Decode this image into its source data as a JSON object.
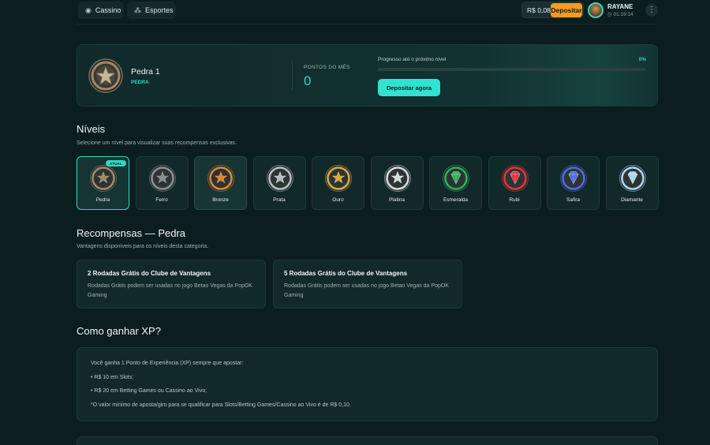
{
  "nav": {
    "casino_label": "Cassino",
    "sports_label": "Esportes"
  },
  "account": {
    "balance": "R$ 0,08",
    "deposit_label": "Depositar",
    "username": "RAYANE",
    "time": "01:19:14"
  },
  "hero": {
    "level_name": "Pedra 1",
    "level_tier": "PEDRA",
    "points_label": "PONTOS DO MÊS",
    "points_value": "0",
    "progress_label": "Progresso até o próximo nível",
    "progress_pct_text": "0%",
    "progress_fraction": 0,
    "cta_label": "Depositar agora"
  },
  "levels_section": {
    "title": "Níveis",
    "subtitle": "Selecione um nível para visualizar suas recompensas exclusivas.",
    "current_badge": "ATUAL",
    "items": [
      {
        "label": "Pedra",
        "icon": "star-medal-icon",
        "color": "#a08a6a"
      },
      {
        "label": "Ferro",
        "icon": "star-medal-icon",
        "color": "#8c8f92"
      },
      {
        "label": "Bronze",
        "icon": "star-medal-icon",
        "color": "#d9893a"
      },
      {
        "label": "Prata",
        "icon": "star-medal-icon",
        "color": "#b9bec4"
      },
      {
        "label": "Ouro",
        "icon": "star-medal-icon",
        "color": "#d8a84a"
      },
      {
        "label": "Platina",
        "icon": "star-medal-icon",
        "color": "#d6dadd"
      },
      {
        "label": "Esmeralda",
        "icon": "diamond-medal-icon",
        "color": "#2fae5e"
      },
      {
        "label": "Rubi",
        "icon": "diamond-medal-icon",
        "color": "#e0343c"
      },
      {
        "label": "Safira",
        "icon": "diamond-medal-icon",
        "color": "#4a6de0"
      },
      {
        "label": "Diamante",
        "icon": "diamond-medal-icon",
        "color": "#a9d6ec"
      }
    ]
  },
  "rewards": {
    "title": "Recompensas — Pedra",
    "subtitle": "Vantagens disponíveis para os níveis desta categoria.",
    "cards": [
      {
        "title": "2 Rodadas Grátis do Clube de Vantagens",
        "desc": "Rodadas Grátis podem ser usadas no jogo Betao Vegas da PopOK Gaming"
      },
      {
        "title": "5 Rodadas Grátis do Clube de Vantagens",
        "desc": "Rodadas Grátis podem ser usadas no jogo Betao Vegas da PopOK Gaming"
      }
    ]
  },
  "xp": {
    "title": "Como ganhar XP?",
    "lines": [
      "Você ganha 1 Ponto de Experiência (XP) sempre que apostar:",
      "• R$ 10 em Slots;",
      "• R$ 20 em Betting Games ou Cassino ao Vivo;",
      "*O valor mínimo de aposta/giro para se qualificar para Slots/Betting Games/Cassino ao Vivo é de R$ 0,10."
    ]
  },
  "colors": {
    "accent": "#2fd7c4",
    "deposit": "#f89a1c",
    "background": "#0b1d1e"
  }
}
